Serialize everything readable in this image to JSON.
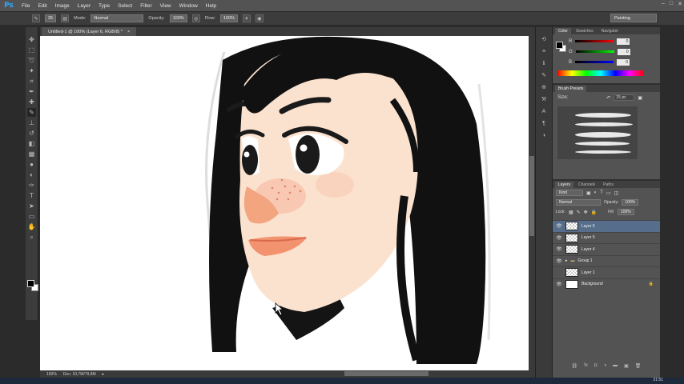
{
  "app": {
    "logo": "Ps"
  },
  "menu": [
    "File",
    "Edit",
    "Image",
    "Layer",
    "Type",
    "Select",
    "Filter",
    "View",
    "Window",
    "Help"
  ],
  "window_controls": [
    "–",
    "□",
    "✕"
  ],
  "options_bar": {
    "mode_label": "Mode:",
    "mode_value": "Normal",
    "opacity_label": "Opacity:",
    "opacity_value": "100%",
    "flow_label": "Flow:",
    "flow_value": "100%",
    "brush_size": "25"
  },
  "workspace": "Painting",
  "document": {
    "tab_title": "Untitled-1 @ 100% (Layer 6, RGB/8) *",
    "tab_close": "×"
  },
  "status": {
    "zoom": "100%",
    "doc_size": "Doc: 10,7M/79,8M"
  },
  "taskbar": {
    "clock": "21:51"
  },
  "color_panel": {
    "tabs": [
      "Color",
      "Swatches",
      "Navigator"
    ],
    "channels": [
      {
        "label": "R",
        "value": "0",
        "color": "#ff3b3b"
      },
      {
        "label": "G",
        "value": "0",
        "color": "#3bd23b"
      },
      {
        "label": "B",
        "value": "0",
        "color": "#3b6bff"
      }
    ]
  },
  "brush_panel": {
    "tab": "Brush Presets",
    "size_label": "Size:",
    "size_value": "25 px"
  },
  "layers_panel": {
    "tabs": [
      "Layers",
      "Channels",
      "Paths"
    ],
    "kind": "Kind",
    "blend_mode": "Normal",
    "opacity_label": "Opacity:",
    "opacity_value": "100%",
    "lock_label": "Lock:",
    "fill_label": "Fill:",
    "fill_value": "100%",
    "layers": [
      {
        "name": "Layer 6",
        "visible": true,
        "selected": true
      },
      {
        "name": "Layer 5",
        "visible": true,
        "selected": false
      },
      {
        "name": "Layer 4",
        "visible": true,
        "selected": false
      },
      {
        "name": "Group 1",
        "visible": true,
        "selected": false,
        "group": true
      },
      {
        "name": "Layer 1",
        "visible": false,
        "selected": false
      },
      {
        "name": "Background",
        "visible": true,
        "selected": false,
        "background": true
      }
    ]
  }
}
